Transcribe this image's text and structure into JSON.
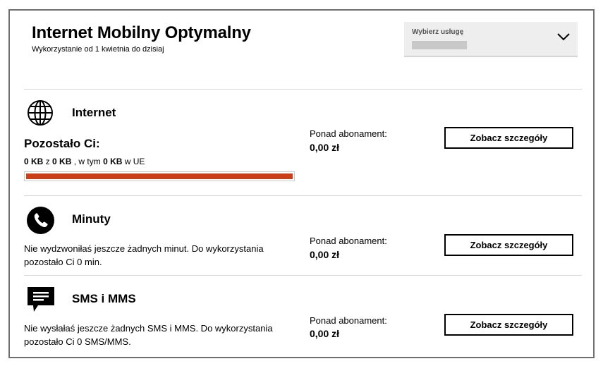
{
  "header": {
    "title": "Internet Mobilny Optymalny",
    "subtitle": "Wykorzystanie od 1 kwietnia do dzisiaj"
  },
  "service_select": {
    "label": "Wybierz usługę",
    "icon": "chevron-down-icon"
  },
  "internet": {
    "title": "Internet",
    "icon": "globe-icon",
    "remaining_heading": "Pozostało Ci:",
    "used": "0 KB",
    "of_word": "z",
    "total": "0 KB",
    "in_that": ", w tym",
    "eu": "0 KB",
    "eu_suffix": "w UE",
    "progress_fraction": 1.0,
    "progress_color": "#c94019",
    "extra_label": "Ponad abonament:",
    "extra_value": "0,00 zł",
    "button_label": "Zobacz szczegóły"
  },
  "minutes": {
    "title": "Minuty",
    "icon": "phone-icon",
    "description": "Nie wydzwoniłaś jeszcze żadnych minut. Do wykorzystania pozostało Ci 0 min.",
    "extra_label": "Ponad abonament:",
    "extra_value": "0,00 zł",
    "button_label": "Zobacz szczegóły"
  },
  "sms": {
    "title": "SMS i MMS",
    "icon": "message-icon",
    "description": "Nie wysłałaś jeszcze żadnych SMS i MMS. Do wykorzystania pozostało Ci 0 SMS/MMS.",
    "extra_label": "Ponad abonament:",
    "extra_value": "0,00 zł",
    "button_label": "Zobacz szczegóły"
  }
}
